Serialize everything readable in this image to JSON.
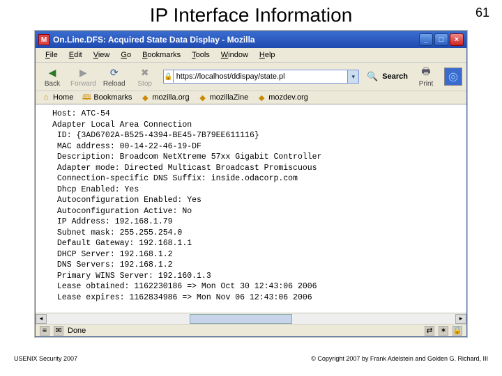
{
  "slide": {
    "title": "IP Interface Information",
    "number": "61"
  },
  "footer": {
    "left": "USENIX Security 2007",
    "right": "© Copyright 2007 by Frank Adelstein and Golden G. Richard, III"
  },
  "window": {
    "title": "On.Line.DFS: Acquired State Data Display - Mozilla",
    "menubar": [
      "File",
      "Edit",
      "View",
      "Go",
      "Bookmarks",
      "Tools",
      "Window",
      "Help"
    ],
    "toolbar": {
      "back": "Back",
      "forward": "Forward",
      "reload": "Reload",
      "stop": "Stop",
      "url": "https://localhost/ddispay/state.pl",
      "search": "Search",
      "print": "Print"
    },
    "bookmarks": {
      "home": "Home",
      "bookmarks": "Bookmarks",
      "mozilla_org": "mozilla.org",
      "mozillazine": "mozillaZine",
      "mozdev": "mozdev.org"
    },
    "status": "Done"
  },
  "content": {
    "lines": [
      "Host: ATC-54",
      "Adapter Local Area Connection",
      " ID: {3AD6702A-B525-4394-BE45-7B79EE611116}",
      " MAC address: 00-14-22-46-19-DF",
      " Description: Broadcom NetXtreme 57xx Gigabit Controller",
      " Adapter mode: Directed Multicast Broadcast Promiscuous",
      " Connection-specific DNS Suffix: inside.odacorp.com",
      " Dhcp Enabled: Yes",
      " Autoconfiguration Enabled: Yes",
      " Autoconfiguration Active: No",
      " IP Address: 192.168.1.79",
      " Subnet mask: 255.255.254.0",
      " Default Gateway: 192.168.1.1",
      " DHCP Server: 192.168.1.2",
      " DNS Servers: 192.168.1.2",
      " Primary WINS Server: 192.160.1.3",
      " Lease obtained: 1162230186 => Mon Oct 30 12:43:06 2006",
      " Lease expires: 1162834986 => Mon Nov 06 12:43:06 2006"
    ]
  }
}
